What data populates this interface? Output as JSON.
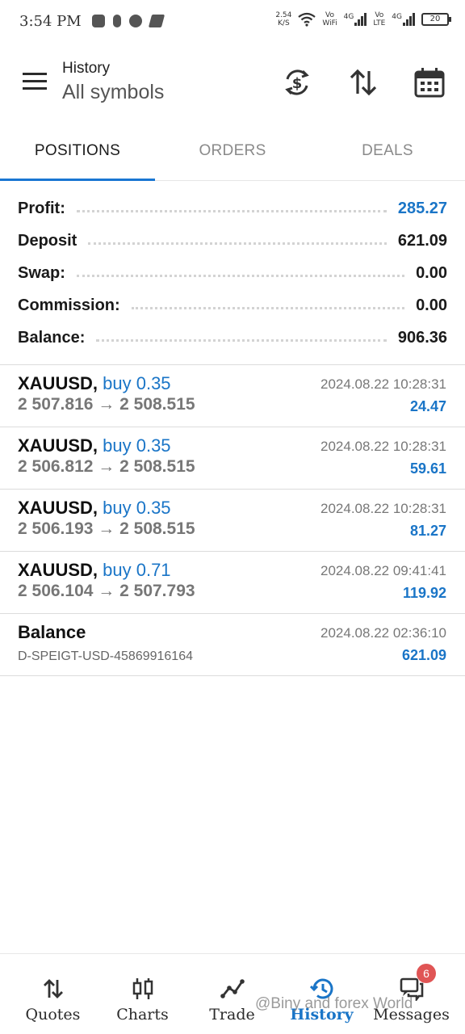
{
  "status_bar": {
    "time": "3:54 PM",
    "net_speed": "2.54",
    "net_unit": "K/S",
    "wifi_label_top": "Vo",
    "wifi_label_bottom": "WiFi",
    "sim1_label": "4G",
    "volte_top": "Vo",
    "volte_bottom": "LTE",
    "sim2_label": "4G",
    "battery": "20"
  },
  "header": {
    "title": "History",
    "subtitle": "All symbols",
    "icons": [
      "currency-exchange-icon",
      "sort-icon",
      "calendar-icon"
    ]
  },
  "tabs": [
    {
      "label": "POSITIONS",
      "active": true
    },
    {
      "label": "ORDERS",
      "active": false
    },
    {
      "label": "DEALS",
      "active": false
    }
  ],
  "summary": [
    {
      "label": "Profit:",
      "value": "285.27",
      "color": "#1a75c7"
    },
    {
      "label": "Deposit",
      "value": "621.09"
    },
    {
      "label": "Swap:",
      "value": "0.00"
    },
    {
      "label": "Commission:",
      "value": "0.00"
    },
    {
      "label": "Balance:",
      "value": "906.36"
    }
  ],
  "deals": [
    {
      "symbol": "XAUUSD,",
      "side": "buy 0.35",
      "open": "2 507.816",
      "arrow": "→",
      "close": "2 508.515",
      "time": "2024.08.22 10:28:31",
      "profit": "24.47"
    },
    {
      "symbol": "XAUUSD,",
      "side": "buy 0.35",
      "open": "2 506.812",
      "arrow": "→",
      "close": "2 508.515",
      "time": "2024.08.22 10:28:31",
      "profit": "59.61"
    },
    {
      "symbol": "XAUUSD,",
      "side": "buy 0.35",
      "open": "2 506.193",
      "arrow": "→",
      "close": "2 508.515",
      "time": "2024.08.22 10:28:31",
      "profit": "81.27"
    },
    {
      "symbol": "XAUUSD,",
      "side": "buy 0.71",
      "open": "2 506.104",
      "arrow": "→",
      "close": "2 507.793",
      "time": "2024.08.22 09:41:41",
      "profit": "119.92"
    }
  ],
  "balance_entry": {
    "label": "Balance",
    "comment": "D-SPEIGT-USD-45869916164",
    "time": "2024.08.22 02:36:10",
    "amount": "621.09"
  },
  "bottom_nav": [
    {
      "label": "Quotes",
      "icon": "quotes-icon"
    },
    {
      "label": "Charts",
      "icon": "charts-icon"
    },
    {
      "label": "Trade",
      "icon": "trade-icon"
    },
    {
      "label": "History",
      "icon": "history-icon",
      "active": true
    },
    {
      "label": "Messages",
      "icon": "messages-icon",
      "badge": "6"
    }
  ],
  "watermark": "@Biny and forex World",
  "colors": {
    "accent": "#1a75c7",
    "indicator": "#1976d2",
    "badge": "#e05555"
  }
}
